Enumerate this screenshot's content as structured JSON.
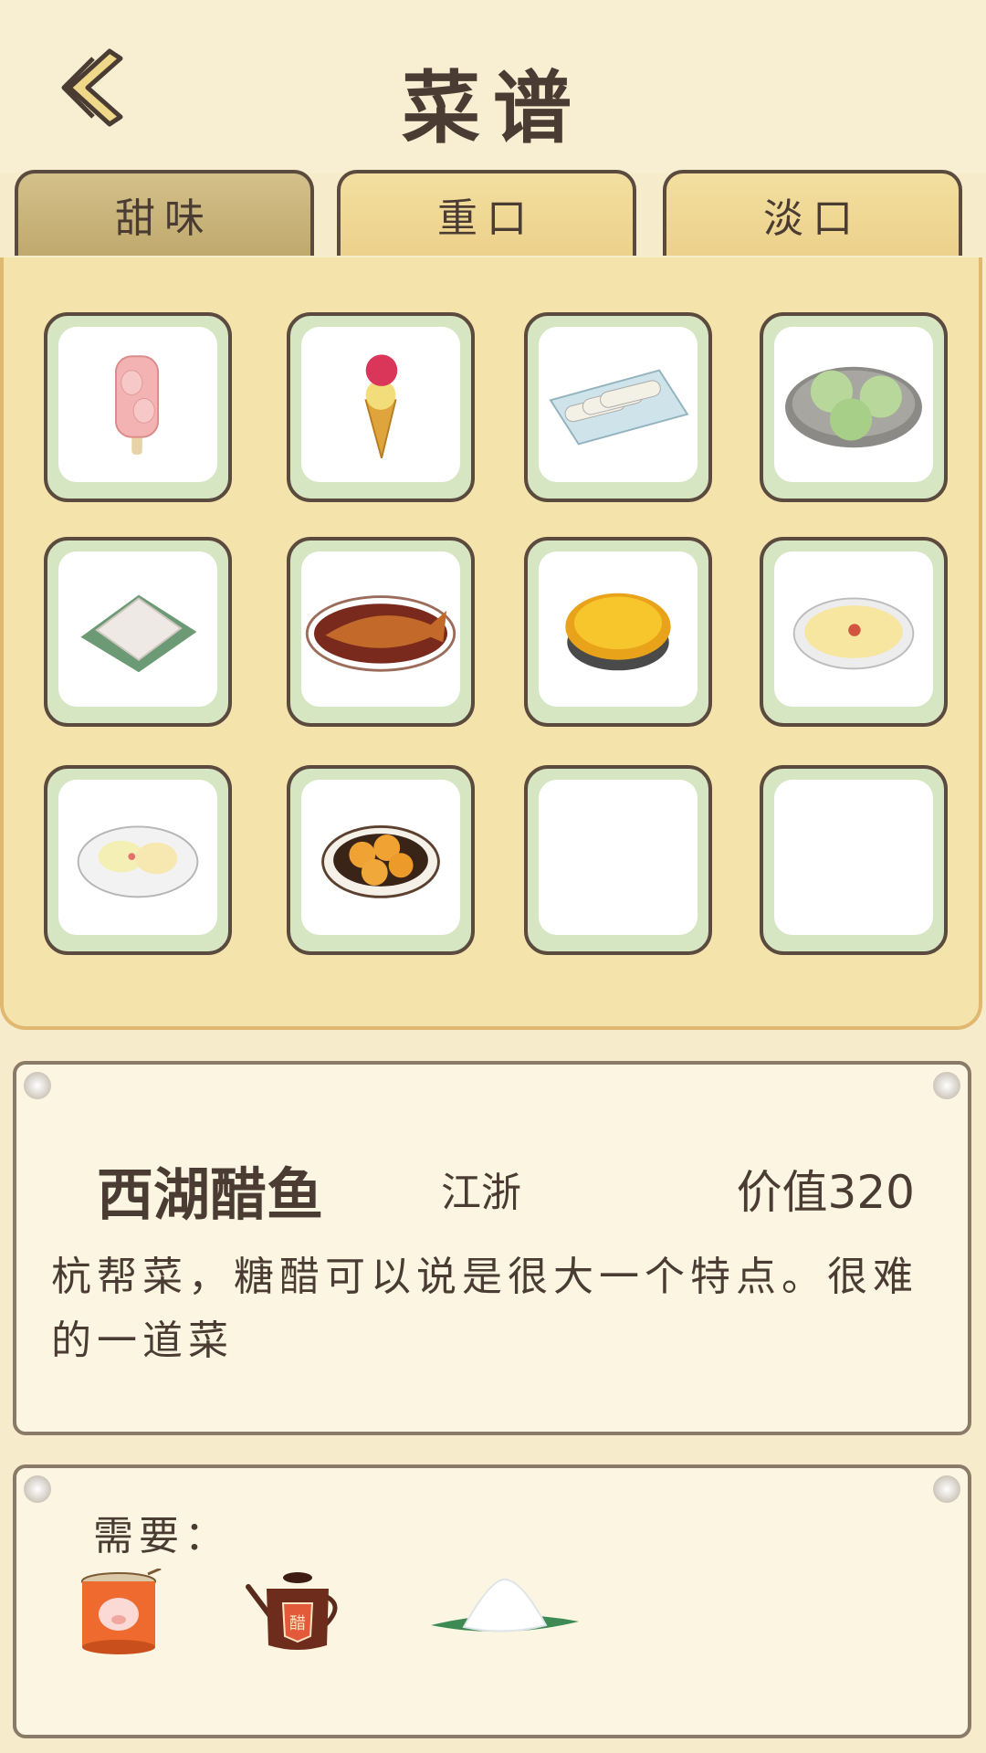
{
  "header": {
    "title": "菜谱",
    "back_icon": "back-chevron-icon"
  },
  "tabs": [
    {
      "label": "甜味",
      "active": true
    },
    {
      "label": "重口",
      "active": false
    },
    {
      "label": "淡口",
      "active": false
    }
  ],
  "recipes": [
    {
      "icon": "strawberry-popsicle-icon"
    },
    {
      "icon": "ice-cream-cone-icon"
    },
    {
      "icon": "rice-rolls-icon"
    },
    {
      "icon": "green-mochi-icon"
    },
    {
      "icon": "white-cake-icon"
    },
    {
      "icon": "vinegar-fish-icon"
    },
    {
      "icon": "egg-custard-tart-icon"
    },
    {
      "icon": "omelette-plate-icon"
    },
    {
      "icon": "steamed-buns-plate-icon"
    },
    {
      "icon": "glazed-balls-plate-icon"
    },
    {
      "icon": ""
    },
    {
      "icon": ""
    }
  ],
  "detail": {
    "name": "西湖醋鱼",
    "region": "江浙",
    "value": "价值320",
    "description": "杭帮菜，糖醋可以说是很大一个特点。很难的一道菜"
  },
  "requirements": {
    "label": "需要：",
    "items": [
      {
        "icon": "canned-pork-icon"
      },
      {
        "icon": "vinegar-pot-icon",
        "text": "醋"
      },
      {
        "icon": "sugar-icon"
      }
    ]
  },
  "colors": {
    "background": "#f6ebcb",
    "panel": "#f5e3ac",
    "cell_border": "#5b4a3e",
    "cell_rim": "#d7e6c2",
    "text": "#4a3c33"
  }
}
